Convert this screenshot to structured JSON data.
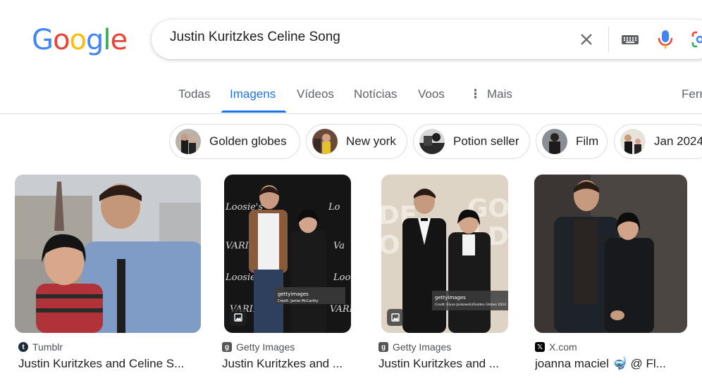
{
  "logo": {
    "text": "Google"
  },
  "search": {
    "query": "Justin Kuritzkes Celine Song"
  },
  "tabs": [
    {
      "label": "Todas"
    },
    {
      "label": "Imagens"
    },
    {
      "label": "Vídeos"
    },
    {
      "label": "Notícias"
    },
    {
      "label": "Voos"
    },
    {
      "label": "Mais"
    },
    {
      "label": "Ferr"
    }
  ],
  "chips": [
    {
      "label": "Golden globes"
    },
    {
      "label": "New york"
    },
    {
      "label": "Potion seller"
    },
    {
      "label": "Film"
    },
    {
      "label": "Jan 2024"
    }
  ],
  "results": [
    {
      "source": "Tumblr",
      "title": "Justin Kuritzkes and Celine S..."
    },
    {
      "source": "Getty Images",
      "title": "Justin Kuritzkes and ...",
      "watermark": "gettyimages",
      "credit": "Credit: Jamie McCarthy"
    },
    {
      "source": "Getty Images",
      "title": "Justin Kuritzkes and ...",
      "watermark": "gettyimages",
      "credit": "Credit: Elyse Jankowski/Golden Globes 2024"
    },
    {
      "source": "X.com",
      "title": "joanna maciel 🤿 @ Fl..."
    }
  ],
  "colors": {
    "accent": "#1a73e8",
    "tab_inactive": "#5f6368",
    "logo_blue": "#4285f4",
    "logo_red": "#ea4335",
    "logo_yellow": "#fbbc05",
    "logo_green": "#34a853"
  }
}
